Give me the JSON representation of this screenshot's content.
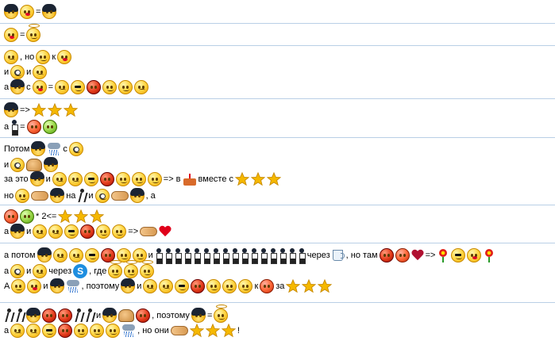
{
  "lines": [
    {
      "t1": "="
    },
    {
      "t1": "="
    },
    {
      "t1": ", но",
      "t2": "к"
    },
    {
      "t1": "и",
      "t2": "и"
    },
    {
      "t1": "а",
      "t2": "с",
      "t3": "="
    },
    {
      "t1": "=>"
    },
    {
      "t1": "а",
      "t2": "="
    },
    {
      "t1": "Потом",
      "t2": "с"
    },
    {
      "t1": "и"
    },
    {
      "t1": "за это",
      "t2": "и",
      "t3": "=> в",
      "t4": "вместе с"
    },
    {
      "t1": "но",
      "t2": "на",
      "t3": "и",
      ",t4": ", а"
    },
    {
      "t1": "* 2<="
    },
    {
      "t1": "а",
      "t2": "и",
      "t3": "=>"
    },
    {
      "t1": "а потом",
      "t2": "и",
      "t3": "через",
      ",t4": ", но там",
      "t5": "=>"
    },
    {
      "t1": "а",
      "t2": "и",
      "t3": "через",
      "t4": ", где"
    },
    {
      "t1": "А",
      "t2": "и",
      "t3": ", поэтому",
      "t4": "и",
      "t5": "к",
      "t6": "за"
    },
    {
      "t1": "и",
      "t2": ", поэтому",
      "t3": "="
    },
    {
      "t1": "а",
      "t2": ", но они",
      "t3": "!"
    }
  ],
  "colors": {
    "separator": "#b9cfe6",
    "star": "#f5b800",
    "heart": "#e0001a"
  }
}
